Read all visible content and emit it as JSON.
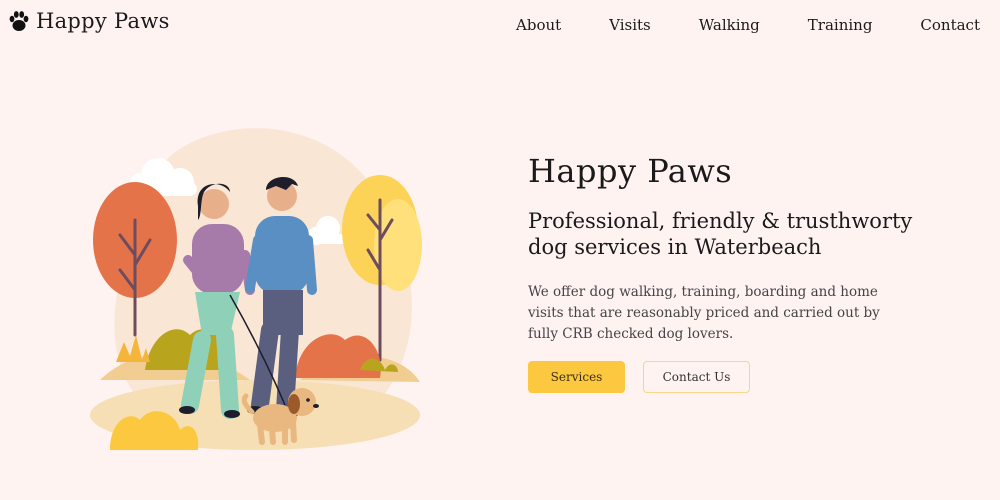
{
  "brand": {
    "name": "Happy Paws",
    "icon": "paw-icon"
  },
  "nav": {
    "items": [
      "About",
      "Visits",
      "Walking",
      "Training",
      "Contact"
    ]
  },
  "hero": {
    "title": "Happy Paws",
    "subtitle": "Professional, friendly & trusthworty dog services in Waterbeach",
    "description": "We offer dog walking, training, boarding and home visits that are reasonably priced and carried out by fully CRB checked dog lovers.",
    "primary_button": "Services",
    "secondary_button": "Contact Us"
  },
  "colors": {
    "background": "#fff3f2",
    "accent": "#fcc840",
    "accent_border": "#f6d68b"
  }
}
